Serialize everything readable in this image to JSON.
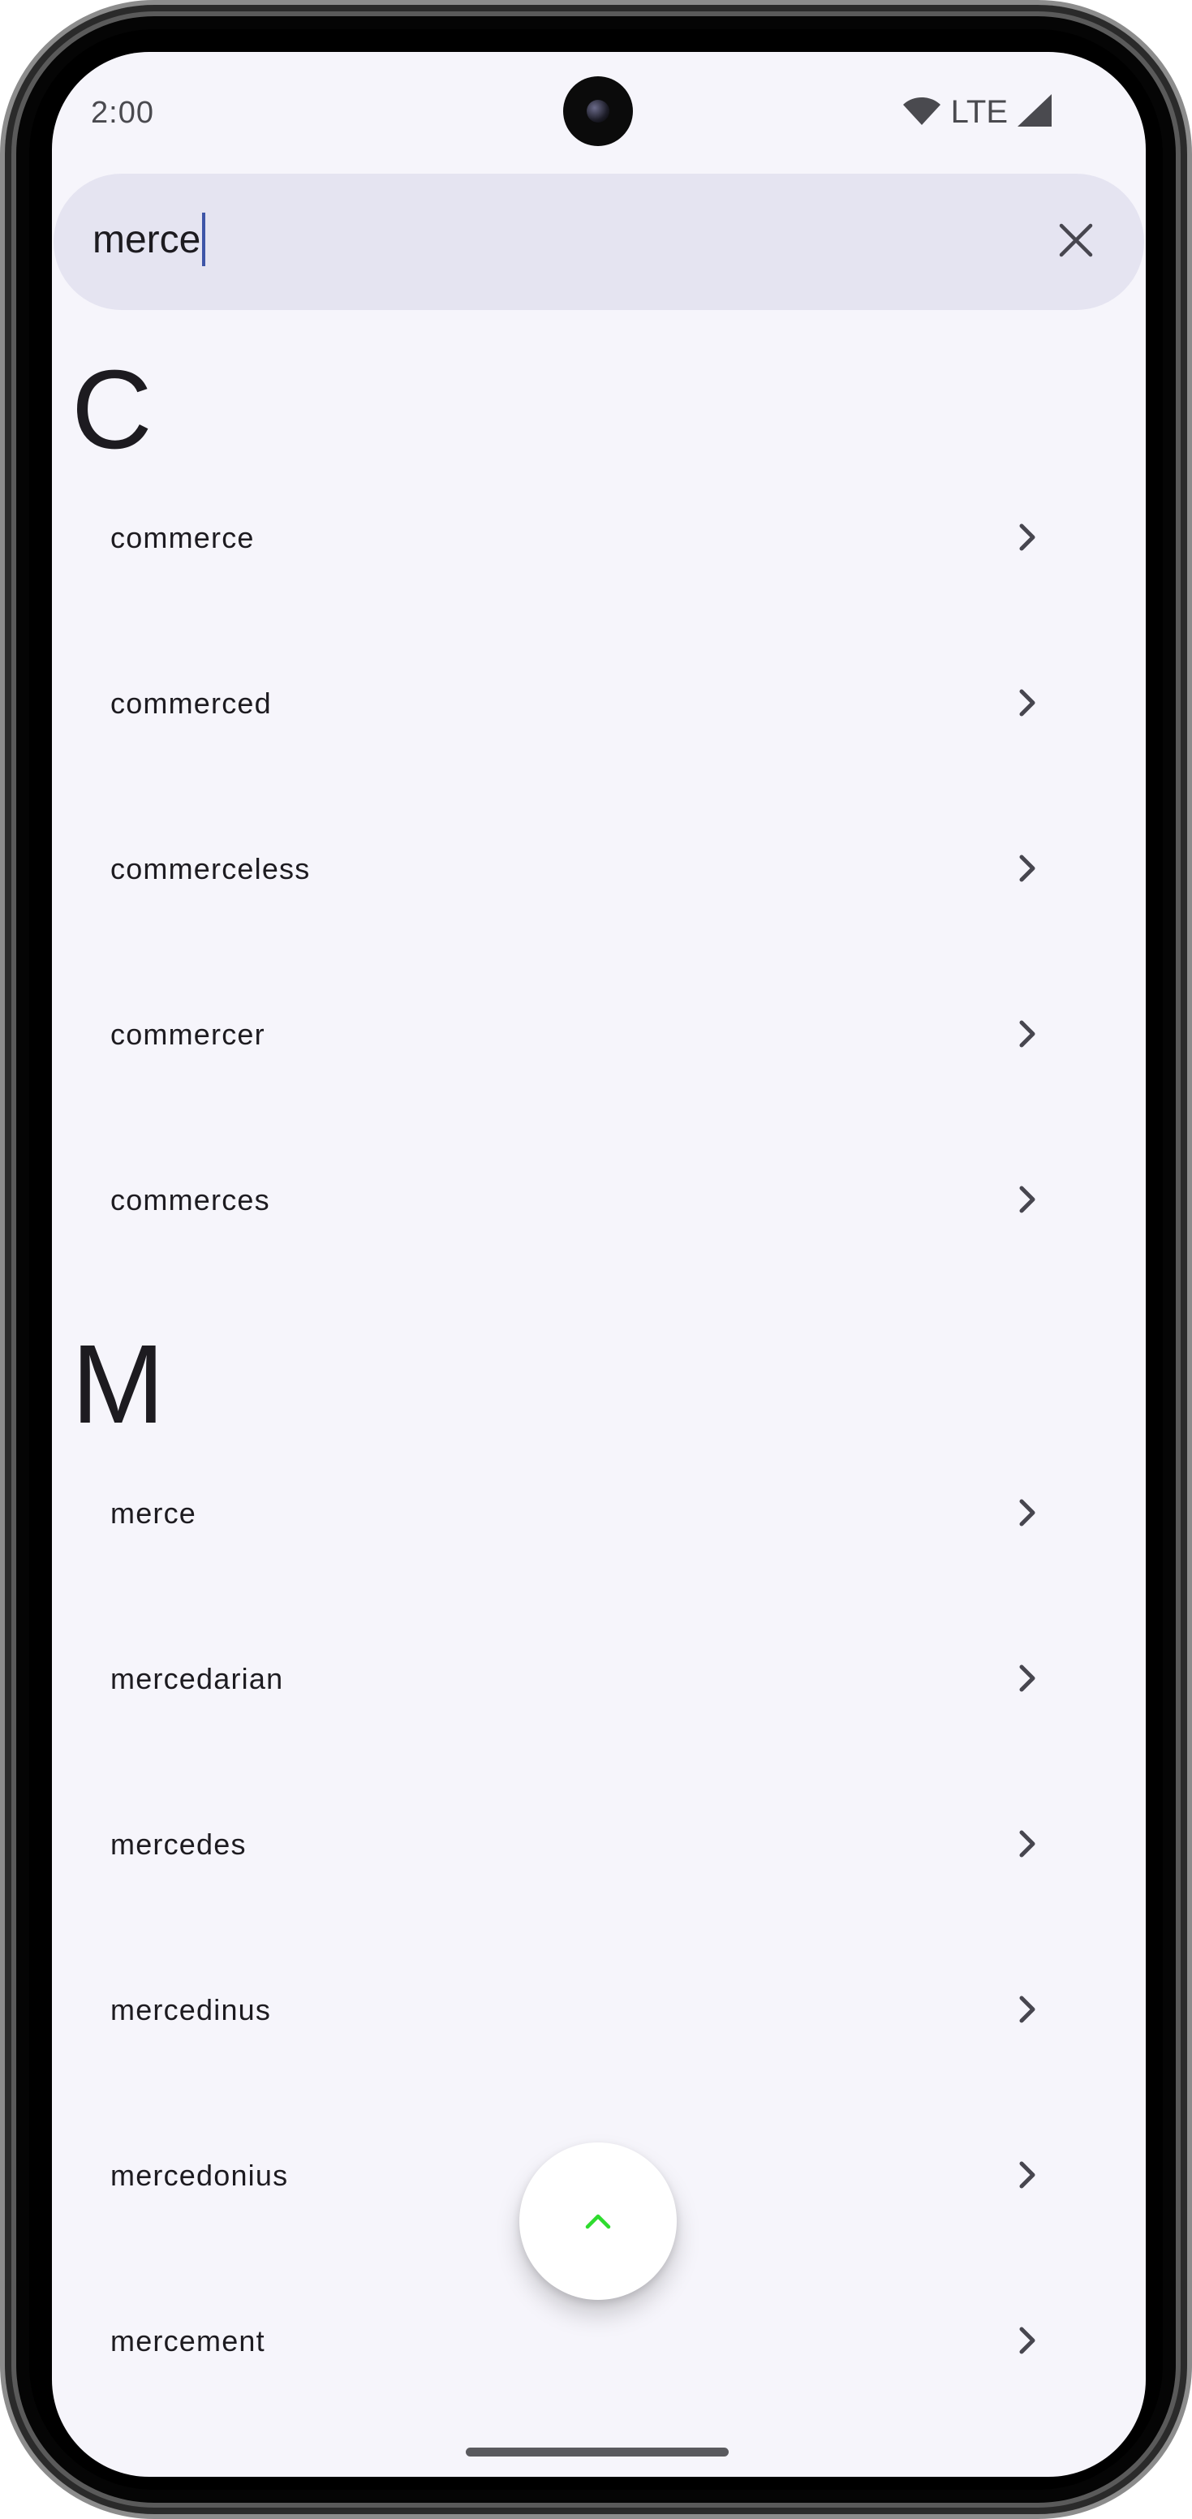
{
  "status_bar": {
    "time": "2:00",
    "network": "LTE"
  },
  "search": {
    "query": "merce",
    "clear_icon": "close-icon"
  },
  "sections": [
    {
      "letter": "C",
      "items": [
        "commerce",
        "commerced",
        "commerceless",
        "commercer",
        "commerces"
      ]
    },
    {
      "letter": "M",
      "items": [
        "merce",
        "mercedarian",
        "mercedes",
        "mercedinus",
        "mercedonius",
        "mercement"
      ]
    }
  ],
  "icons": {
    "row_chevron": "chevron-right-icon",
    "scroll_top": "chevron-up-icon"
  },
  "colors": {
    "background": "#f6f5fb",
    "search_bar": "#e5e4f1",
    "caret": "#3e55a8",
    "fab_icon": "#2edc2e"
  }
}
